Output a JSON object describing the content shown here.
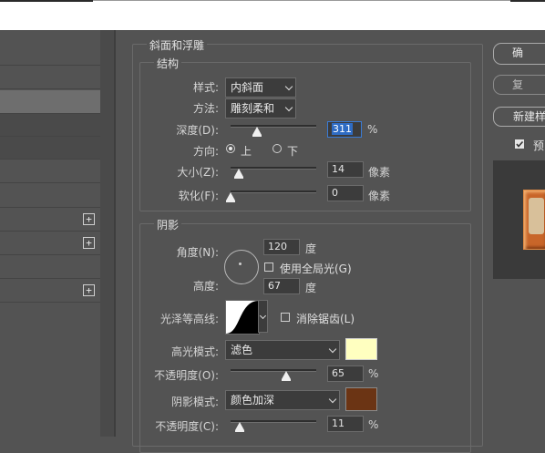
{
  "left_panel": {
    "plus_symbol": "+"
  },
  "bevel": {
    "group_title": "斜面和浮雕",
    "structure_title": "结构",
    "style_label": "样式:",
    "style_value": "内斜面",
    "technique_label": "方法:",
    "technique_value": "雕刻柔和",
    "depth_label": "深度(D):",
    "depth_value": "311",
    "depth_unit": "%",
    "depth_fraction": 0.31,
    "direction_label": "方向:",
    "direction_up": "上",
    "direction_down": "下",
    "size_label": "大小(Z):",
    "size_value": "14",
    "size_unit": "像素",
    "size_fraction": 0.1,
    "soften_label": "软化(F):",
    "soften_value": "0",
    "soften_unit": "像素",
    "soften_fraction": 0.0
  },
  "shading": {
    "title": "阴影",
    "angle_label": "角度(N):",
    "angle_value": "120",
    "angle_unit": "度",
    "global_light_label": "使用全局光(G)",
    "altitude_label": "高度:",
    "altitude_value": "67",
    "altitude_unit": "度",
    "gloss_contour_label": "光泽等高线:",
    "anti_aliased_label": "消除锯齿(L)",
    "highlight_mode_label": "高光模式:",
    "highlight_mode_value": "滤色",
    "highlight_color": "#ffffc0",
    "highlight_opacity_label": "不透明度(O):",
    "highlight_opacity_value": "65",
    "highlight_opacity_unit": "%",
    "highlight_opacity_fraction": 0.65,
    "shadow_mode_label": "阴影模式:",
    "shadow_mode_value": "颜色加深",
    "shadow_color": "#6b3414",
    "shadow_opacity_label": "不透明度(C):",
    "shadow_opacity_value": "11",
    "shadow_opacity_unit": "%",
    "shadow_opacity_fraction": 0.11
  },
  "right_panel": {
    "ok_label": "确",
    "reset_label": "复",
    "new_style_label": "新建样",
    "preview_label": "预"
  }
}
